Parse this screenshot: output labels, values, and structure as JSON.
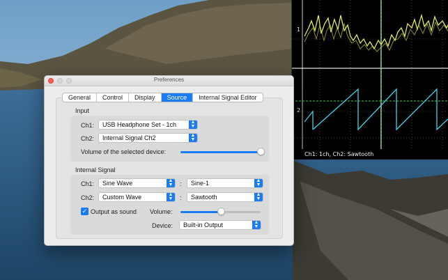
{
  "preferences": {
    "title": "Preferences",
    "tabs": [
      {
        "label": "General"
      },
      {
        "label": "Control"
      },
      {
        "label": "Display"
      },
      {
        "label": "Source",
        "active": true
      },
      {
        "label": "Internal Signal Editor"
      }
    ],
    "input": {
      "heading": "Input",
      "ch1_label": "Ch1:",
      "ch1_value": "USB Headphone Set - 1ch",
      "ch2_label": "Ch2:",
      "ch2_value": "Internal Signal Ch2",
      "volume_label": "Volume of the selected device:",
      "volume_level": 1.0
    },
    "internal_signal": {
      "heading": "Internal Signal",
      "ch1_label": "Ch1:",
      "ch1_waveform": "Sine Wave",
      "ch1_separator": ":",
      "ch1_preset": "Sine-1",
      "ch2_label": "Ch2:",
      "ch2_waveform": "Custom Wave",
      "ch2_separator": ":",
      "ch2_preset": "Sawtooth",
      "output_as_sound_label": "Output as sound",
      "output_as_sound_checked": true,
      "volume_label": "Volume:",
      "volume_level": 0.5,
      "device_label": "Device:",
      "device_value": "Built-in Output"
    }
  },
  "scope": {
    "ch1_marker": "1",
    "ch2_marker": "2",
    "status": "Ch1: 1ch, Ch2: Sawtooth",
    "colors": {
      "ch1": "#e6e85a",
      "ch2": "#3fd3e6",
      "grid": "#7a7a7a",
      "trigger": "#3bd24a"
    }
  },
  "colors": {
    "accent": "#1a7cf5",
    "close": "#fd5f57"
  }
}
